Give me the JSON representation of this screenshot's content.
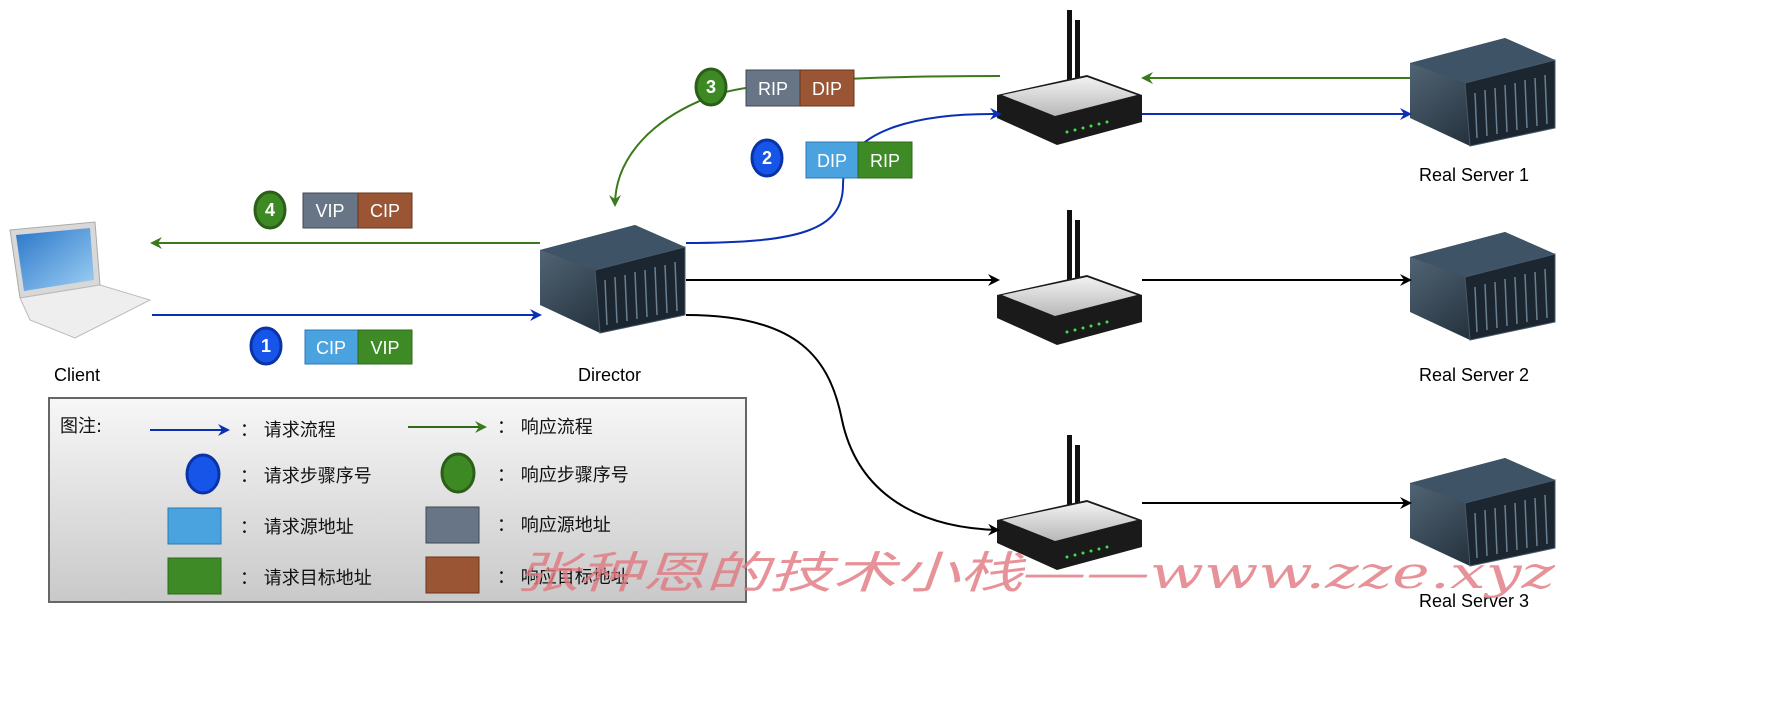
{
  "nodes": {
    "client": "Client",
    "director": "Director",
    "real_server_1": "Real Server 1",
    "real_server_2": "Real Server 2",
    "real_server_3": "Real Server 3"
  },
  "steps": [
    {
      "number": "1",
      "type": "request",
      "src": "CIP",
      "dst": "VIP"
    },
    {
      "number": "2",
      "type": "request",
      "src": "DIP",
      "dst": "RIP"
    },
    {
      "number": "3",
      "type": "response",
      "src": "RIP",
      "dst": "DIP"
    },
    {
      "number": "4",
      "type": "response",
      "src": "VIP",
      "dst": "CIP"
    }
  ],
  "legend": {
    "title": "图注:",
    "request_flow": "： 请求流程",
    "response_flow": "： 响应流程",
    "request_step": "： 请求步骤序号",
    "response_step": "： 响应步骤序号",
    "request_src": "： 请求源地址",
    "response_src": "： 响应源地址",
    "request_dst": "： 请求目标地址",
    "response_dst": "： 响应目标地址"
  },
  "watermark": "张种恩的技术小栈——www.zze.xyz",
  "colors": {
    "request_line": "#0a2fb5",
    "response_line": "#3b7a1c",
    "request_circle": "#1655e8",
    "response_circle": "#3d8a25",
    "request_src_box": "#4aa3df",
    "request_dst_box": "#3d8a27",
    "response_src_box": "#687587",
    "response_dst_box": "#9a5535"
  }
}
